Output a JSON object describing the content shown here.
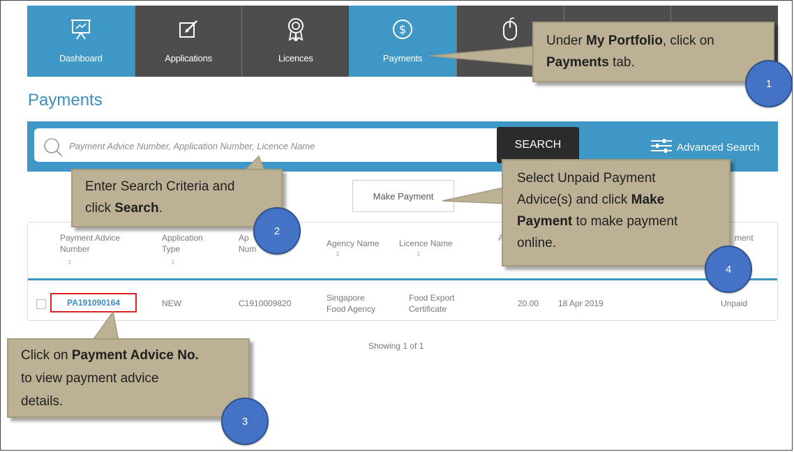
{
  "nav": {
    "tabs": [
      {
        "label": "Dashboard",
        "icon": "presentation-icon"
      },
      {
        "label": "Applications",
        "icon": "edit-icon"
      },
      {
        "label": "Licences",
        "icon": "ribbon-icon"
      },
      {
        "label": "Payments",
        "icon": "dollar-icon"
      },
      {
        "label": "",
        "icon": "mouse-icon"
      },
      {
        "label": "",
        "icon": "unknown-icon"
      },
      {
        "label": "",
        "icon": "unknown-icon"
      }
    ]
  },
  "page": {
    "title": "Payments"
  },
  "search": {
    "placeholder": "Payment Advice Number, Application Number, Licence Name",
    "button_label": "SEARCH",
    "advanced_label": "Advanced Search"
  },
  "actions": {
    "make_payment_label": "Make Payment"
  },
  "table": {
    "headers": {
      "payment_advice_1": "Payment Advice",
      "payment_advice_2": "Number",
      "application_type_1": "Application",
      "application_type_2": "Type",
      "application_number_1": "Ap",
      "application_number_2": "Num",
      "agency_name": "Agency Name",
      "licence_name": "Licence Name",
      "amount_partial": "A",
      "payment_status_partial": "ment"
    },
    "row": {
      "payment_advice_no": "PA191090164",
      "application_type": "NEW",
      "application_number": "C1910009820",
      "agency_1": "Singapore",
      "agency_2": "Food Agency",
      "licence_1": "Food Export",
      "licence_2": "Certificate",
      "amount": "20.00",
      "date": "18 Apr 2019",
      "status": "Unpaid"
    },
    "showing": "Showing 1 of 1"
  },
  "callouts": {
    "c1": {
      "pre": "Under ",
      "bold1": "My Portfolio",
      "mid": ", click on",
      "bold2": "Payments",
      "post": " tab.",
      "step": "1"
    },
    "c2": {
      "line1": "Enter Search Criteria and",
      "pre": "click ",
      "bold": "Search",
      "post": ".",
      "step": "2"
    },
    "c3": {
      "pre": "Click on ",
      "bold": "Payment Advice No.",
      "line2": "to view payment advice",
      "line3": "details.",
      "step": "3"
    },
    "c4": {
      "line1": "Select Unpaid Payment",
      "pre": "Advice(s) and click ",
      "bold1": "Make",
      "bold2": "Payment",
      "post": " to make payment",
      "line4": "online.",
      "step": "4"
    }
  },
  "colors": {
    "nav_active": "#3e97c4",
    "nav_inactive": "#4d4d4d",
    "callout_bg": "#bcb194",
    "step_badge": "#4472c4",
    "highlight_border": "#e02020"
  }
}
